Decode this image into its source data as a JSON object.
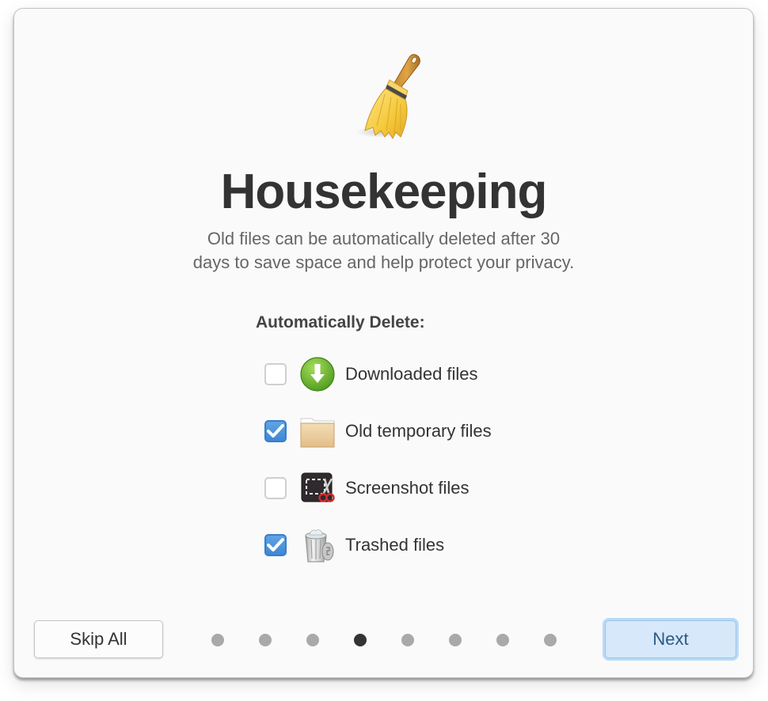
{
  "dialog": {
    "hero_icon": "broom-icon",
    "title": "Housekeeping",
    "description_lines": [
      "Old files can be automatically deleted after 30",
      "days to save space and help protect your privacy."
    ],
    "section_label": "Automatically Delete:"
  },
  "options": [
    {
      "label": "Downloaded files",
      "icon": "download-arrow-icon",
      "checked": false
    },
    {
      "label": "Old temporary files",
      "icon": "folder-icon",
      "checked": true
    },
    {
      "label": "Screenshot files",
      "icon": "screenshot-scissors-icon",
      "checked": false
    },
    {
      "label": "Trashed files",
      "icon": "trash-can-icon",
      "checked": true
    }
  ],
  "footer": {
    "skip_label": "Skip All",
    "next_label": "Next",
    "pagination": {
      "total_pages": 8,
      "current_page": 4
    }
  },
  "colors": {
    "accent": "#3f87d3",
    "next_button_bg": "#d6e8f9",
    "active_dot": "#333333",
    "inactive_dot": "#a9a9a9"
  }
}
